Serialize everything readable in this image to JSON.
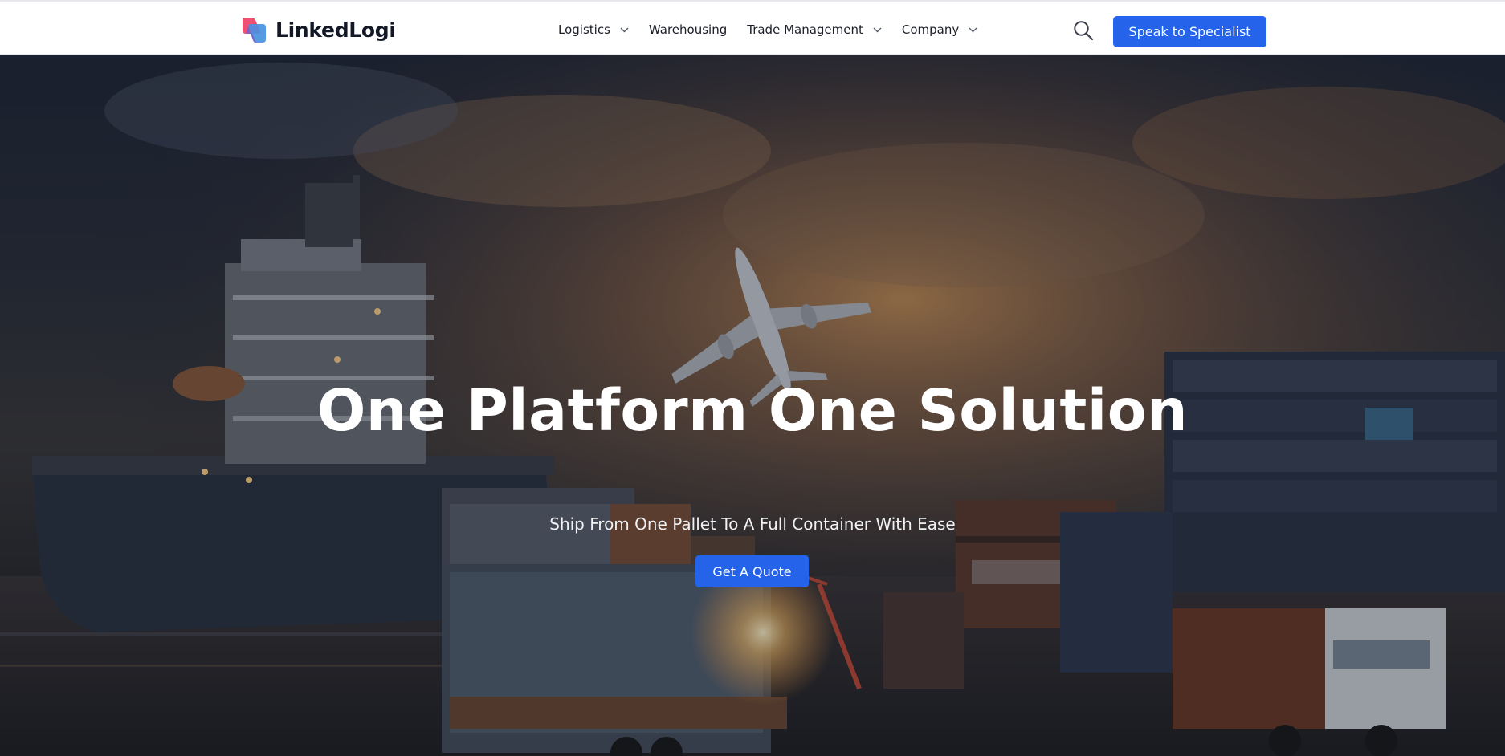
{
  "header": {
    "brand": {
      "name": "LinkedLogi",
      "icon": "linkedlogi-logo-icon"
    },
    "nav": [
      {
        "label": "Logistics",
        "has_dropdown": true
      },
      {
        "label": "Warehousing",
        "has_dropdown": false
      },
      {
        "label": "Trade Management",
        "has_dropdown": true
      },
      {
        "label": "Company",
        "has_dropdown": true
      }
    ],
    "search_icon": "search-icon",
    "cta_label": "Speak to Specialist"
  },
  "hero": {
    "title": "One Platform One Solution",
    "subtitle": "Ship From One Pallet To A Full Container With Ease",
    "cta_label": "Get A Quote"
  },
  "colors": {
    "accent": "#2563eb",
    "header_bg": "#ffffff",
    "nav_text": "#1b1f2a",
    "hero_text": "#ffffff"
  }
}
